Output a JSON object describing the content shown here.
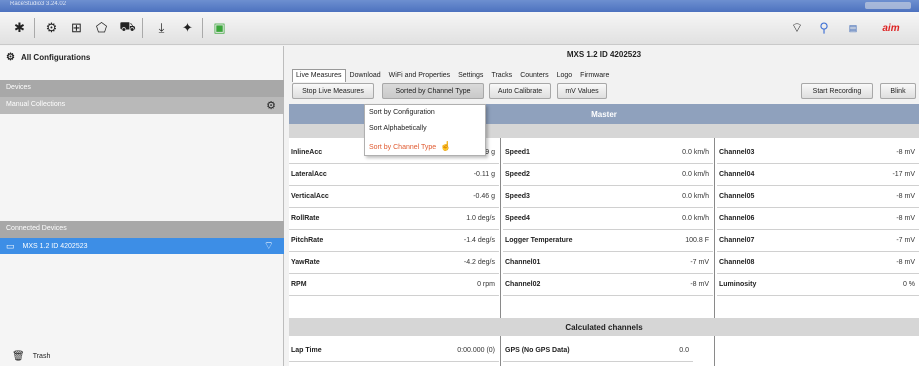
{
  "window": {
    "title": "RaceStudio3 3.24.02"
  },
  "left_panel": {
    "all_configurations": "All Configurations",
    "devices_header": "Devices",
    "manual_collections": "Manual Collections",
    "connected_devices_header": "Connected Devices",
    "connected_device": "MXS 1.2 ID 4202523",
    "trash": "Trash"
  },
  "main": {
    "device_title": "MXS 1.2 ID 4202523",
    "tabs": [
      {
        "label": "Live Measures"
      },
      {
        "label": "Download"
      },
      {
        "label": "WiFi and Properties"
      },
      {
        "label": "Settings"
      },
      {
        "label": "Tracks"
      },
      {
        "label": "Counters"
      },
      {
        "label": "Logo"
      },
      {
        "label": "Firmware"
      }
    ],
    "buttons": {
      "stop_live": "Stop Live Measures",
      "sorted_by": "Sorted by Channel Type",
      "auto_calibrate": "Auto Calibrate",
      "mv_values": "mV Values",
      "start_recording": "Start Recording",
      "blink": "Blink"
    },
    "sort_menu": {
      "items": [
        "Sort by Configuration",
        "Sort Alphabetically",
        "Sort by Channel Type"
      ]
    },
    "sections": {
      "master": "Master",
      "calculated": "Calculated channels"
    },
    "columns": [
      {
        "rows": [
          {
            "name": "InlineAcc",
            "value": "0.69 g"
          },
          {
            "name": "LateralAcc",
            "value": "-0.11 g"
          },
          {
            "name": "VerticalAcc",
            "value": "-0.46 g"
          },
          {
            "name": "RollRate",
            "value": "1.0 deg/s"
          },
          {
            "name": "PitchRate",
            "value": "-1.4 deg/s"
          },
          {
            "name": "YawRate",
            "value": "-4.2 deg/s"
          },
          {
            "name": "RPM",
            "value": "0 rpm"
          }
        ]
      },
      {
        "rows": [
          {
            "name": "Speed1",
            "value": "0.0 km/h"
          },
          {
            "name": "Speed2",
            "value": "0.0 km/h"
          },
          {
            "name": "Speed3",
            "value": "0.0 km/h"
          },
          {
            "name": "Speed4",
            "value": "0.0 km/h"
          },
          {
            "name": "Logger Temperature",
            "value": "100.8 F"
          },
          {
            "name": "Channel01",
            "value": "-7 mV"
          },
          {
            "name": "Channel02",
            "value": "-8 mV"
          }
        ]
      },
      {
        "rows": [
          {
            "name": "Channel03",
            "value": "-8 mV"
          },
          {
            "name": "Channel04",
            "value": "-17 mV"
          },
          {
            "name": "Channel05",
            "value": "-8 mV"
          },
          {
            "name": "Channel06",
            "value": "-8 mV"
          },
          {
            "name": "Channel07",
            "value": "-7 mV"
          },
          {
            "name": "Channel08",
            "value": "-8 mV"
          },
          {
            "name": "Luminosity",
            "value": "0 %"
          }
        ]
      }
    ],
    "calculated_rows": [
      {
        "name": "Lap Time",
        "value": "0:00.000 (0)"
      },
      {
        "name": "GPS (No GPS Data)",
        "value": "0.0"
      }
    ]
  },
  "colors": {
    "selection_blue": "#3d8ee6",
    "master_bar": "#8fa1bd",
    "menu_highlight": "#e05a30"
  }
}
